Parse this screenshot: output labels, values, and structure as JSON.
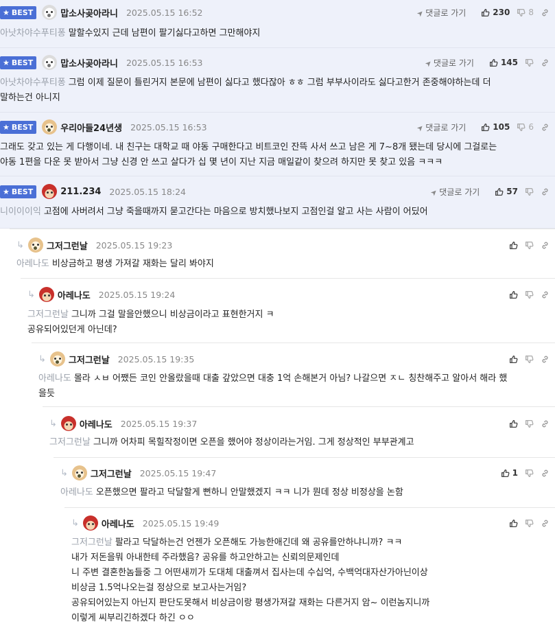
{
  "labels": {
    "best": "BEST",
    "goto_reply": "댓글로 가기"
  },
  "comments": [
    {
      "best": true,
      "avatar": "white-dog",
      "nick": "맙소사곶아라니",
      "date": "2025.05.15 16:52",
      "likes": "230",
      "dislikes": "8",
      "goto": true,
      "mention": "아낫차야수푸티퐁",
      "lines": [
        "말할수있지 근데 남편이 팔기싫다고하면 그만해야지"
      ]
    },
    {
      "best": true,
      "avatar": "white-dog",
      "nick": "맙소사곶아라니",
      "date": "2025.05.15 16:53",
      "likes": "145",
      "dislikes": "",
      "goto": true,
      "mention": "아낫차야수푸티퐁",
      "lines": [
        "그럼 이제 질문이 틀린거지 본문에 남편이 싫다고 했다잖아 ㅎㅎ 그럼 부부사이라도 싫다고한거 존중해야하는데 더",
        "말하는건 아니지"
      ]
    },
    {
      "best": true,
      "avatar": "dog",
      "nick": "우리아들24년생",
      "date": "2025.05.15 16:53",
      "likes": "105",
      "dislikes": "6",
      "goto": true,
      "mention": "",
      "lines": [
        "그래도 갖고 있는 게 다행이네. 내 친구는 대학교 때 야동 구매한다고 비트코인 잔뜩 사서 쓰고 남은 게 7~8개 됐는데 당시에 그걸로는",
        "야동 1편을 다운 못 받아서 그냥 신경 안 쓰고 살다가 십 몇 년이 지난 지금 매일같이 찾으려 하지만 못 찾고 있음 ㅋㅋㅋ"
      ]
    },
    {
      "best": true,
      "avatar": "red-dog",
      "nick": "211.234",
      "date": "2025.05.15 18:24",
      "likes": "57",
      "dislikes": "",
      "goto": true,
      "mention": "니이이이익",
      "lines": [
        "고점에 사버려서 그냥 죽을때까지 묻고간다는 마음으로 방치했나보지 고점인걸 알고 사는 사람이 어딨어"
      ]
    },
    {
      "best": false,
      "avatar": "dog",
      "nick": "그저그런날",
      "date": "2025.05.15 19:23",
      "likes": "",
      "dislikes": "",
      "goto": false,
      "mention": "아레나도",
      "lines": [
        "비상금하고 평생 가져갈 재화는 달리 봐야지"
      ]
    },
    {
      "best": false,
      "avatar": "red-dog",
      "nick": "아레나도",
      "date": "2025.05.15 19:24",
      "likes": "",
      "dislikes": "",
      "goto": false,
      "mention": "그저그런날",
      "lines": [
        "그니까 그걸 말을안했으니 비상금이라고 표현한거지 ㅋ",
        "공유되어있던게 아닌데?"
      ]
    },
    {
      "best": false,
      "avatar": "dog",
      "nick": "그저그런날",
      "date": "2025.05.15 19:35",
      "likes": "",
      "dislikes": "",
      "goto": false,
      "mention": "아레나도",
      "lines": [
        "몰라 ㅅㅂ 어쨌든 코인 안올랐을때 대출 갚았으면 대충 1억 손해본거 아님? 나갈으면 ㅈㄴ 칭찬해주고 알아서 해라 했",
        "을듯"
      ]
    },
    {
      "best": false,
      "avatar": "red-dog",
      "nick": "아레나도",
      "date": "2025.05.15 19:37",
      "likes": "",
      "dislikes": "",
      "goto": false,
      "mention": "그저그런날",
      "lines": [
        "그니까 어차피 목힐작정이면 오픈을 했어야 정상이라는거임. 그게 정상적인 부부관계고"
      ]
    },
    {
      "best": false,
      "avatar": "dog",
      "nick": "그저그런날",
      "date": "2025.05.15 19:47",
      "likes": "1",
      "dislikes": "",
      "goto": false,
      "mention": "아레나도",
      "lines": [
        "오픈했으면 팔라고 닥달할게 뻔하니 안말했겠지 ㅋㅋ 니가 뭔데 정상 비정상을 논함"
      ]
    },
    {
      "best": false,
      "avatar": "red-dog",
      "nick": "아레나도",
      "date": "2025.05.15 19:49",
      "likes": "",
      "dislikes": "",
      "goto": false,
      "mention": "그저그런날",
      "lines": [
        "팔라고 닥달하는건 언젠가 오픈해도 가능한애긴데 왜 공유를안하냐니까? ㅋㅋ",
        "내가 저돈을뭐 아내한테 주라했음? 공유를 하고안하고는 신뢰의문제인데",
        "니 주변 결혼한놈들중 그 어떤새끼가 도대체 대출껴서 집사는데 수십억, 수백억대자산가아닌이상",
        "비상금 1.5억나오는걸 정상으로 보고사는거임?",
        "공유되어있는지 아닌지 판단도못해서 비상금이랑 평생가져갈 재화는 다른거지 암~ 이런놈지니까",
        "이렇게 씨부리긴하겠다 하긴 ㅇㅇ"
      ]
    }
  ]
}
